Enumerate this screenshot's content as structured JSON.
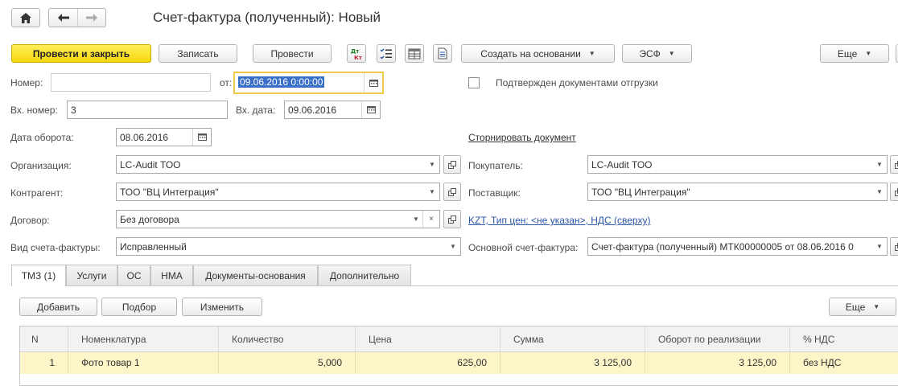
{
  "title": "Счет-фактура (полученный): Новый",
  "nav": {
    "home_icon": "home-icon",
    "back_icon": "arrow-left-icon",
    "forward_icon": "arrow-right-icon"
  },
  "toolbar": {
    "post_close": "Провести и закрыть",
    "save": "Записать",
    "post": "Провести",
    "create_based": "Создать на основании",
    "esf": "ЭСФ",
    "more": "Еще"
  },
  "form": {
    "number_label": "Номер:",
    "number_value": "",
    "from_label": "от:",
    "from_value": "09.06.2016  0:00:00",
    "confirmed_label": "Подтвержден документами отгрузки",
    "in_number_label": "Вх. номер:",
    "in_number_value": "3",
    "in_date_label": "Вх. дата:",
    "in_date_value": "09.06.2016",
    "turnover_date_label": "Дата оборота:",
    "turnover_date_value": "08.06.2016",
    "storno_link": "Сторнировать документ",
    "org_label": "Организация:",
    "org_value": "LC-Audit ТОО",
    "buyer_label": "Покупатель:",
    "buyer_value": "LC-Audit ТОО",
    "counterparty_label": "Контрагент:",
    "counterparty_value": "ТОО \"ВЦ Интеграция\"",
    "supplier_label": "Поставщик:",
    "supplier_value": "ТОО \"ВЦ Интеграция\"",
    "contract_label": "Договор:",
    "contract_value": "Без договора",
    "price_link": "KZT, Тип цен: <не указан>, НДС (сверху)",
    "invoice_type_label": "Вид счета-фактуры:",
    "invoice_type_value": "Исправленный",
    "base_invoice_label": "Основной счет-фактура:",
    "base_invoice_value": "Счет-фактура (полученный) МТК00000005 от 08.06.2016 0"
  },
  "tabs": [
    "ТМЗ (1)",
    "Услуги",
    "ОС",
    "НМА",
    "Документы-основания",
    "Дополнительно"
  ],
  "table_toolbar": {
    "add": "Добавить",
    "select": "Подбор",
    "change": "Изменить",
    "more": "Еще"
  },
  "table": {
    "columns": [
      "N",
      "Номенклатура",
      "Количество",
      "Цена",
      "Сумма",
      "Оборот по реализации",
      "% НДС"
    ],
    "rows": [
      {
        "n": "1",
        "item": "Фото товар  1",
        "qty": "5,000",
        "price": "625,00",
        "sum": "3 125,00",
        "turnover": "3 125,00",
        "vat": "без НДС"
      }
    ]
  },
  "colors": {
    "primary": "#f5d80b",
    "link": "#2a56a8",
    "focus": "#f2c84b",
    "row_selected": "#fbf5c8"
  }
}
